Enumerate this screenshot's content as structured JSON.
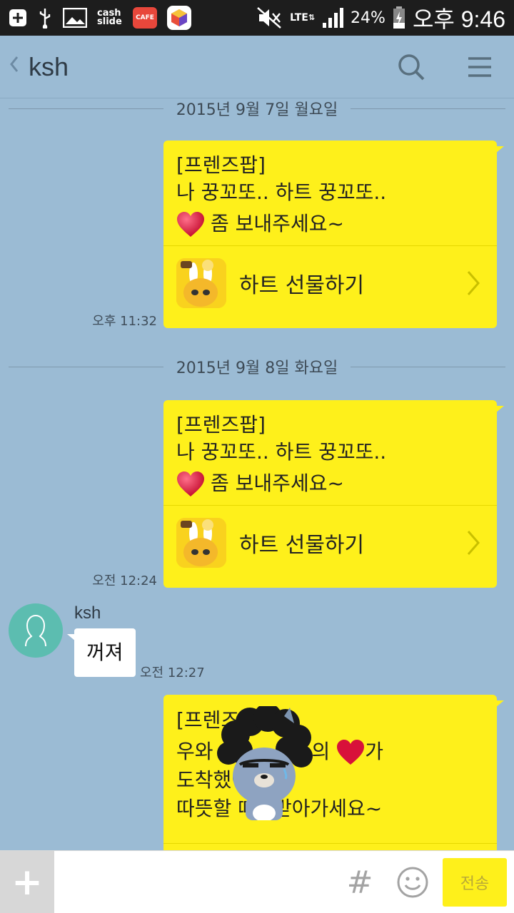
{
  "status_bar": {
    "cashslide_label": "cash slide",
    "cafe_label": "CAFE",
    "network": "LTE",
    "battery": "24%",
    "time": "오후 9:46"
  },
  "header": {
    "back_icon": "chevron-left-icon",
    "title": "ksh",
    "search_icon": "search-icon",
    "menu_icon": "menu-icon"
  },
  "chat": {
    "date_1": "2015년 9월 7일 월요일",
    "date_2": "2015년 9월 8일 화요일",
    "messages": [
      {
        "line1": "[프렌즈팝]",
        "line2": "나 꿍꼬또.. 하트 꿍꼬또..",
        "line3": "좀 보내주세요~",
        "link_label": "하트 선물하기",
        "time": "오후 11:32"
      },
      {
        "line1": "[프렌즈팝]",
        "line2": "나 꿍꼬또.. 하트 꿍꼬또..",
        "line3": "좀 보내주세요~",
        "link_label": "하트 선물하기",
        "time": "오전 12:24"
      }
    ],
    "incoming": {
      "sender": "ksh",
      "text": "꺼져",
      "time": "오전 12:27"
    },
    "partial": {
      "line1": "[프렌즈",
      "line2a": "우와",
      "line2b": "의",
      "line2c": "가",
      "line3": "도착했어",
      "line4a": "따뜻할 때",
      "line4b": "받아가세요~"
    }
  },
  "input_bar": {
    "plus_label": "+",
    "hash_label": "#",
    "send_label": "전송"
  },
  "colors": {
    "chat_bg": "#9bbbd4",
    "bubble_yellow": "#fef01b",
    "avatar_teal": "#5cbdb0"
  }
}
